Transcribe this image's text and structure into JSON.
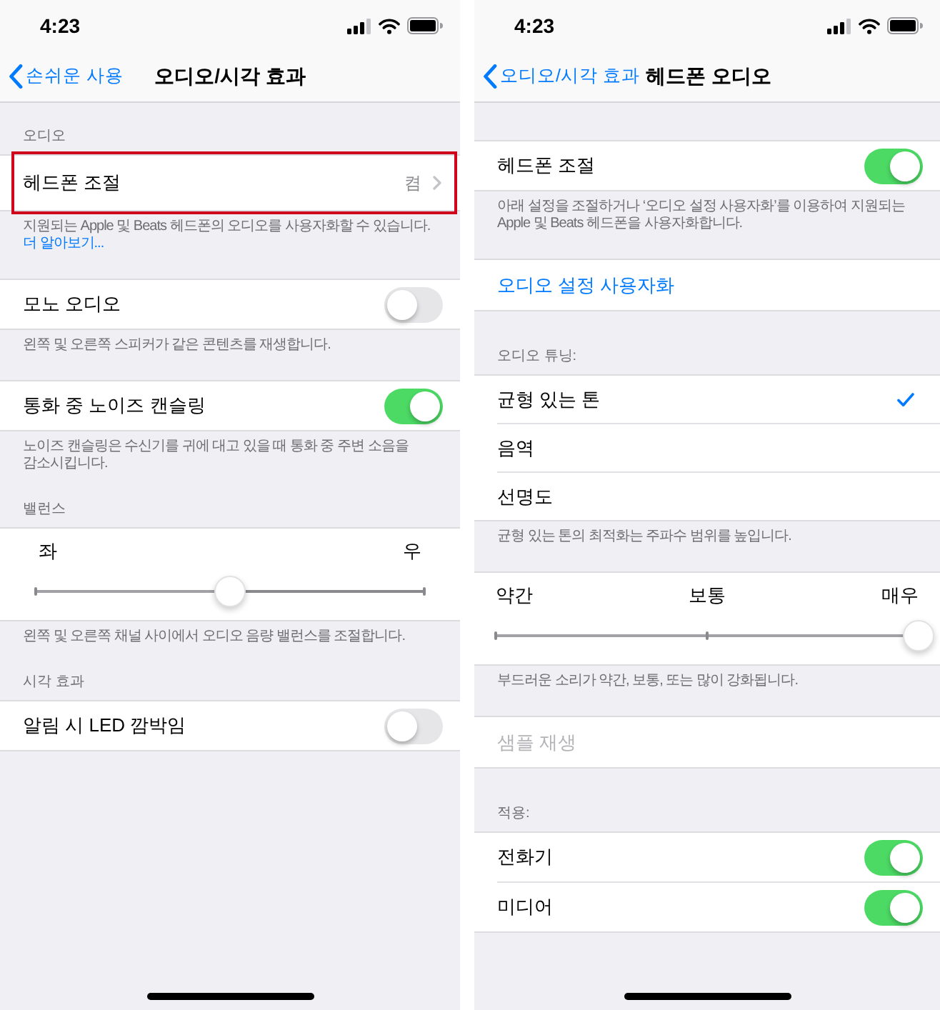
{
  "screens": [
    {
      "status_bar": {
        "time": "4:23"
      },
      "nav": {
        "back": "손쉬운 사용",
        "title": "오디오/시각 효과"
      },
      "groups": [
        {
          "header": "오디오",
          "rows": [
            {
              "kind": "value",
              "label": "헤드폰 조절",
              "value": "켬",
              "highlighted": true
            }
          ],
          "footer": {
            "text": "지원되는 Apple 및 Beats 헤드폰의 오디오를 사용자화할 수 있습니다.",
            "link": "더 알아보기..."
          }
        },
        {
          "rows": [
            {
              "kind": "toggle",
              "label": "모노 오디오",
              "on": false
            }
          ],
          "footer": {
            "text": "왼쪽 및 오른쪽 스피커가 같은 콘텐츠를 재생합니다."
          }
        },
        {
          "rows": [
            {
              "kind": "toggle",
              "label": "통화 중 노이즈 캔슬링",
              "on": true
            }
          ],
          "footer": {
            "text": "노이즈 캔슬링은 수신기를 귀에 대고 있을 때 통화 중 주변 소음을 감소시킵니다."
          }
        },
        {
          "header": "밸런스",
          "rows": [
            {
              "kind": "slider",
              "labels": [
                "좌",
                "우"
              ],
              "level": 0.5
            }
          ],
          "footer": {
            "text": "왼쪽 및 오른쪽 채널 사이에서 오디오 음량 밸런스를 조절합니다."
          }
        },
        {
          "header": "시각 효과",
          "rows": [
            {
              "kind": "toggle",
              "label": "알림 시 LED 깜박임",
              "on": false
            }
          ]
        }
      ]
    },
    {
      "status_bar": {
        "time": "4:23"
      },
      "nav": {
        "back": "오디오/시각 효과",
        "title": "헤드폰 오디오"
      },
      "groups": [
        {
          "rows": [
            {
              "kind": "toggle",
              "label": "헤드폰 조절",
              "on": true
            }
          ],
          "footer": {
            "text": "아래 설정을 조절하거나 ‘오디오 설정 사용자화’를 이용하여 지원되는 Apple 및 Beats 헤드폰을 사용자화합니다."
          }
        },
        {
          "rows": [
            {
              "kind": "link",
              "label": "오디오 설정 사용자화",
              "disabled": false
            }
          ]
        },
        {
          "header": "오디오 튜닝:",
          "rows": [
            {
              "kind": "option",
              "label": "균형 있는 톤",
              "selected": true
            },
            {
              "kind": "option",
              "label": "음역",
              "selected": false
            },
            {
              "kind": "option",
              "label": "선명도",
              "selected": false
            }
          ],
          "footer": {
            "text": "균형 있는 톤의 최적화는 주파수 범위를 높입니다."
          }
        },
        {
          "rows": [
            {
              "kind": "slider",
              "labels": [
                "약간",
                "보통",
                "매우"
              ],
              "level": 1
            }
          ],
          "footer": {
            "text": "부드러운 소리가 약간, 보통, 또는 많이 강화됩니다."
          }
        },
        {
          "rows": [
            {
              "kind": "link",
              "label": "샘플 재생",
              "disabled": true
            }
          ]
        },
        {
          "header": "적용:",
          "rows": [
            {
              "kind": "toggle",
              "label": "전화기",
              "on": true
            },
            {
              "kind": "toggle",
              "label": "미디어",
              "on": true
            }
          ]
        }
      ]
    }
  ]
}
